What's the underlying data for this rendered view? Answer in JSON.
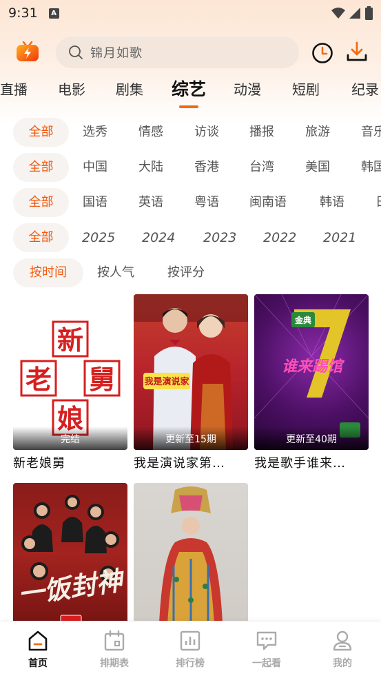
{
  "status": {
    "time": "9:31",
    "notif_letter": "A"
  },
  "header": {
    "logo_icon": "tv-lightning-icon",
    "search_placeholder": "锦月如歌",
    "history_icon": "clock-icon",
    "download_icon": "download-icon"
  },
  "categories": [
    "直播",
    "电影",
    "剧集",
    "综艺",
    "动漫",
    "短剧",
    "纪录"
  ],
  "active_category": "综艺",
  "filters": {
    "genre": [
      "全部",
      "选秀",
      "情感",
      "访谈",
      "播报",
      "旅游",
      "音乐"
    ],
    "region": [
      "全部",
      "中国",
      "大陆",
      "香港",
      "台湾",
      "美国",
      "韩国"
    ],
    "language": [
      "全部",
      "国语",
      "英语",
      "粤语",
      "闽南语",
      "韩语",
      "日语"
    ],
    "year": [
      "全部",
      "2025",
      "2024",
      "2023",
      "2022",
      "2021"
    ],
    "sort": [
      "按时间",
      "按人气",
      "按评分"
    ]
  },
  "shows": [
    {
      "title": "新老娘舅",
      "badge": "完结",
      "poster_chars": [
        "新",
        "老",
        "舅",
        "娘"
      ]
    },
    {
      "title": "我是演说家第…",
      "badge": "更新至15期",
      "poster_text": "我是演说家"
    },
    {
      "title": "我是歌手谁来…",
      "badge": "更新至40期",
      "poster_text": "谁来踢馆",
      "sponsor": "金典"
    },
    {
      "title": "",
      "badge": "",
      "poster_text": "一饭封神"
    },
    {
      "title": "",
      "badge": ""
    }
  ],
  "bottom_nav": [
    {
      "label": "首页",
      "icon": "home-icon",
      "active": true
    },
    {
      "label": "排期表",
      "icon": "calendar-icon",
      "active": false
    },
    {
      "label": "排行榜",
      "icon": "ranking-chart-icon",
      "active": false
    },
    {
      "label": "一起看",
      "icon": "chat-bubble-icon",
      "active": false
    },
    {
      "label": "我的",
      "icon": "user-icon",
      "active": false
    }
  ],
  "colors": {
    "accent": "#f26b14",
    "active_chip_text": "#f2580c"
  }
}
